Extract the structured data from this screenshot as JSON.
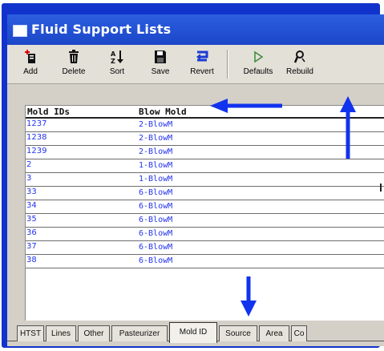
{
  "window": {
    "title": "Fluid Support Lists"
  },
  "toolbar": {
    "buttons": [
      {
        "label": "Add",
        "icon": "add-icon"
      },
      {
        "label": "Delete",
        "icon": "trash-icon"
      },
      {
        "label": "Sort",
        "icon": "sort-az-icon"
      },
      {
        "label": "Save",
        "icon": "save-icon"
      },
      {
        "label": "Revert",
        "icon": "revert-icon"
      },
      {
        "label": "Defaults",
        "icon": "play-icon"
      },
      {
        "label": "Rebuild",
        "icon": "rebuild-icon"
      }
    ]
  },
  "table": {
    "headers": [
      "Mold IDs",
      "Blow Mold"
    ],
    "rows": [
      {
        "id": "1237",
        "mold": "2-BlowM"
      },
      {
        "id": "1238",
        "mold": "2-BlowM"
      },
      {
        "id": "1239",
        "mold": "2-BlowM"
      },
      {
        "id": "2",
        "mold": "1-BlowM"
      },
      {
        "id": "3",
        "mold": "1-BlowM"
      },
      {
        "id": "33",
        "mold": "6-BlowM"
      },
      {
        "id": "34",
        "mold": "6-BlowM"
      },
      {
        "id": "35",
        "mold": "6-BlowM"
      },
      {
        "id": "36",
        "mold": "6-BlowM"
      },
      {
        "id": "37",
        "mold": "6-BlowM"
      },
      {
        "id": "38",
        "mold": "6-BlowM"
      }
    ]
  },
  "tabs": [
    {
      "label": "HTST",
      "active": false
    },
    {
      "label": "Lines",
      "active": false
    },
    {
      "label": "Other",
      "active": false
    },
    {
      "label": "Pasteurizer",
      "active": false
    },
    {
      "label": "Mold ID",
      "active": true
    },
    {
      "label": "Source",
      "active": false
    },
    {
      "label": "Area",
      "active": false
    },
    {
      "label": "Co",
      "active": false
    }
  ],
  "colors": {
    "frame": "#1133cc",
    "titlebar": "#2c5fe0",
    "cell_text": "#2233ee",
    "arrow": "#1133ee"
  }
}
